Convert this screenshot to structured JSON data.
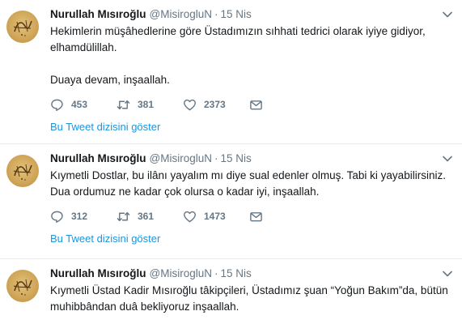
{
  "tweets": [
    {
      "name": "Nurullah Mısıroğlu",
      "handle": "@MisirogluN",
      "dot": "·",
      "time": "15 Nis",
      "text": "Hekimlerin müşâhedlerine göre Üstadımızın sıhhati tedrici olarak iyiye gidiyor, elhamdülillah.\n\nDuaya devam, inşaallah.",
      "replies": "453",
      "retweets": "381",
      "likes": "2373",
      "thread_link": "Bu Tweet dizisini göster"
    },
    {
      "name": "Nurullah Mısıroğlu",
      "handle": "@MisirogluN",
      "dot": "·",
      "time": "15 Nis",
      "text": "Kıymetli Dostlar, bu ilânı yayalım mı diye sual edenler olmuş. Tabi ki yayabilirsiniz. Dua ordumuz ne kadar çok olursa o kadar iyi, inşaallah.",
      "replies": "312",
      "retweets": "361",
      "likes": "1473",
      "thread_link": "Bu Tweet dizisini göster"
    },
    {
      "name": "Nurullah Mısıroğlu",
      "handle": "@MisirogluN",
      "dot": "·",
      "time": "15 Nis",
      "text": "Kıymetli Üstad Kadir Mısıroğlu tâkipçileri, Üstadımız şuan “Yoğun Bakım”da, bütün muhibbândan duâ bekliyoruz inşaallah."
    }
  ],
  "colors": {
    "accent": "#1b95e0",
    "muted": "#657786",
    "text": "#14171a",
    "avatar_gold": "#cfa456"
  }
}
